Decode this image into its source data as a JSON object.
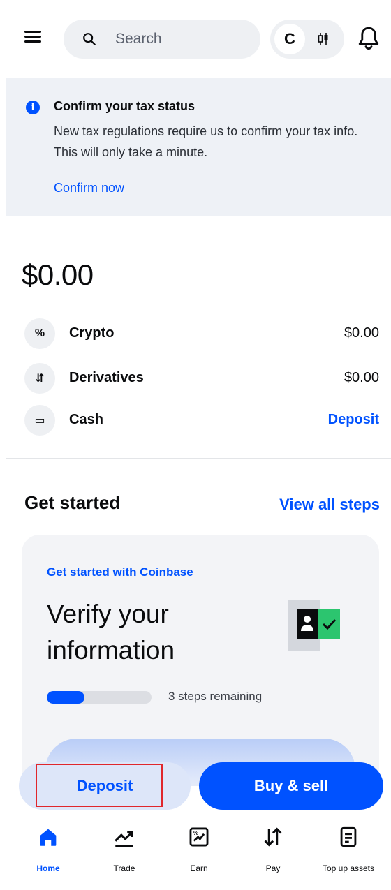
{
  "header": {
    "search_placeholder": "Search",
    "switch_letter": "C"
  },
  "banner": {
    "title": "Confirm your tax status",
    "body": "New tax regulations require us to confirm your tax info. This will only take a minute.",
    "link": "Confirm now"
  },
  "balance": {
    "total": "$0.00",
    "rows": [
      {
        "icon": "percent-icon",
        "glyph": "%",
        "label": "Crypto",
        "value": "$0.00"
      },
      {
        "icon": "arrows-icon",
        "glyph": "⇵",
        "label": "Derivatives",
        "value": "$0.00"
      },
      {
        "icon": "cash-icon",
        "glyph": "▭",
        "label": "Cash",
        "value": "Deposit"
      }
    ]
  },
  "get_started": {
    "title": "Get started",
    "view_all": "View all steps",
    "card": {
      "kicker": "Get started with Coinbase",
      "headline": "Verify your information",
      "progress": 0.36,
      "steps_text": "3 steps remaining"
    }
  },
  "actions": {
    "deposit": "Deposit",
    "buy_sell": "Buy & sell"
  },
  "nav": {
    "items": [
      {
        "label": "Home",
        "icon": "home-icon",
        "active": true
      },
      {
        "label": "Trade",
        "icon": "trade-icon",
        "active": false
      },
      {
        "label": "Earn",
        "icon": "earn-icon",
        "active": false
      },
      {
        "label": "Pay",
        "icon": "pay-icon",
        "active": false
      },
      {
        "label": "Top up assets",
        "icon": "top-up-icon",
        "active": false
      }
    ]
  },
  "colors": {
    "brand_blue": "#0052ff",
    "highlight_red": "#e0272c",
    "verify_green": "#2cc56f"
  }
}
